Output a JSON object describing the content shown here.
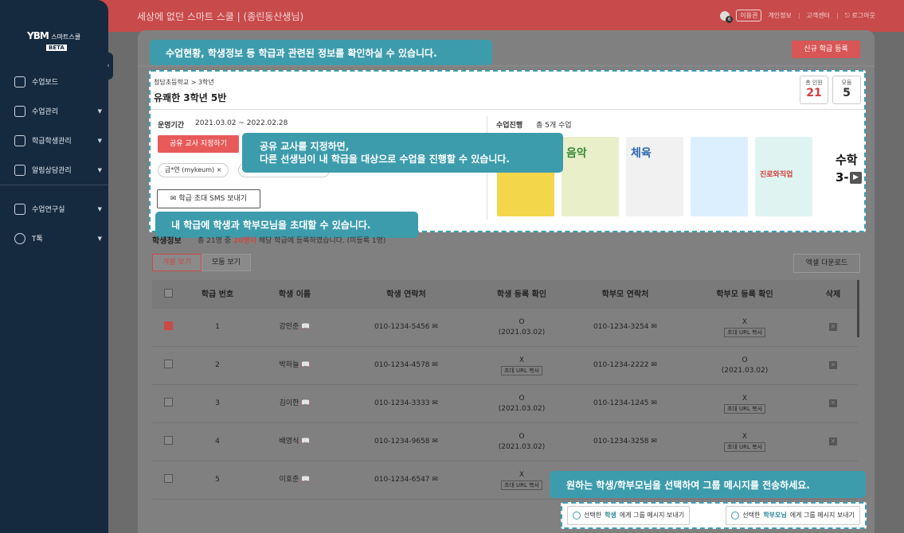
{
  "header": {
    "title": "세상에 없던 스마트 스쿨",
    "school": "(종린동산생님)",
    "notif_count": "6",
    "links": [
      "이용권",
      "개인정보",
      "고객센터",
      "로그아웃"
    ]
  },
  "sidebar": {
    "logo": "YBM",
    "logo_sub": "스마트스쿨",
    "beta": "BETA",
    "items": [
      {
        "label": "수업보드",
        "arrow": ""
      },
      {
        "label": "수업관리",
        "arrow": "▼"
      },
      {
        "label": "학급학생관리",
        "arrow": "▼"
      },
      {
        "label": "알림상담관리",
        "arrow": "▼"
      },
      {
        "label": "수업연구실",
        "arrow": "▼"
      },
      {
        "label": "T톡",
        "arrow": "▼"
      }
    ],
    "collapse": "‹"
  },
  "new_class_button": "신규 학급 등록",
  "class_card": {
    "breadcrumb": "청담초등학교 > 3학년",
    "class_name": "유쾌한 3학년 5반",
    "stats": [
      {
        "label": "총 인원",
        "value": "21",
        "color": "#d83c3c"
      },
      {
        "label": "모둠",
        "value": "5",
        "color": "#222222"
      }
    ],
    "period_label": "운영기간",
    "period_value": "2021.03.02 ~ 2022.02.28",
    "progress_label": "수업진행",
    "progress_value": "총 5개 수업",
    "share_button": "공유 교사 지정하기",
    "chip": "금*연 (mykeum)",
    "chip_close": "×",
    "sms_button": "학급 초대 SMS 보내기",
    "books": [
      {
        "title": "",
        "color": "#f4d64a"
      },
      {
        "title": "음악",
        "color": "#e9efc9"
      },
      {
        "title": "체육",
        "color": "#f1f1f1"
      },
      {
        "title": "",
        "color": "#dcefff"
      },
      {
        "title": "진로와직업",
        "color": "#dff4f0"
      }
    ],
    "more_text": "수학 3-",
    "next": "▶"
  },
  "tooltips": {
    "top": "수업현황, 학생정보 등 학급과 관련된 정보를 확인하실 수 있습니다.",
    "share": "공유 교사를 지정하면,",
    "share2": "다른 선생님이 내 학급을 대상으로 수업을 진행할 수 있습니다.",
    "invite": "내 학급에 학생과 학부모님을 초대할 수 있습니다.",
    "group": "원하는 학생/학부모님을 선택하여 그룹 메시지를 전송하세요."
  },
  "students": {
    "title": "학생정보",
    "summary_pre": "총 21명 중",
    "summary_hl": "20명이",
    "summary_post": "해당 학급에 등록하였습니다. (미등록 1명)",
    "tab_individual": "개별 보기",
    "tab_group": "모둠 보기",
    "excel": "엑셀 다운로드",
    "columns": [
      "학급 번호",
      "학생 이름",
      "학생 연락처",
      "학생 등록 확인",
      "학부모 연락처",
      "학부모 등록 확인",
      "삭제"
    ],
    "copy_label": "초대 URL 복사",
    "rows": [
      {
        "no": "1",
        "name": "강민준",
        "phone": "010-1234-5456",
        "reg": "O",
        "reg_date": "(2021.03.02)",
        "p_phone": "010-1234-3254",
        "p_reg": "X",
        "p_date": "",
        "checked": true
      },
      {
        "no": "2",
        "name": "박하늘",
        "phone": "010-1234-4578",
        "reg": "X",
        "reg_date": "",
        "p_phone": "010-1234-2222",
        "p_reg": "O",
        "p_date": "(2021.03.02)",
        "checked": false
      },
      {
        "no": "3",
        "name": "김이한",
        "phone": "010-1234-3333",
        "reg": "O",
        "reg_date": "(2021.03.02)",
        "p_phone": "010-1234-1245",
        "p_reg": "X",
        "p_date": "",
        "checked": false
      },
      {
        "no": "4",
        "name": "배영식",
        "phone": "010-1234-9658",
        "reg": "O",
        "reg_date": "(2021.03.02)",
        "p_phone": "010-1234-3258",
        "p_reg": "X",
        "p_date": "",
        "checked": false
      },
      {
        "no": "5",
        "name": "이호준",
        "phone": "010-1234-6547",
        "reg": "X",
        "reg_date": "",
        "p_phone": "",
        "p_reg": "",
        "p_date": "",
        "checked": false
      }
    ]
  },
  "actions": {
    "student_pre": "선택한",
    "student_hl": "학생",
    "student_post": "에게 그룹 메시지 보내기",
    "parent_pre": "선택한",
    "parent_hl": "학부모님",
    "parent_post": "에게 그룹 메시지 보내기"
  }
}
